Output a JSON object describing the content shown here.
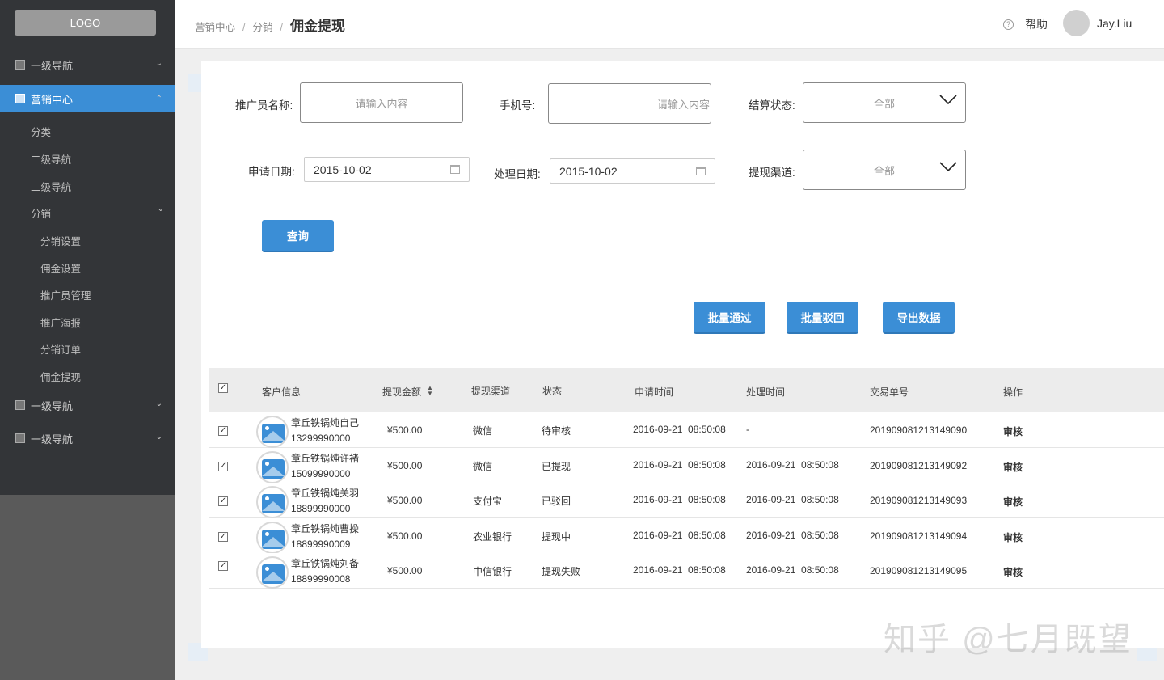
{
  "sidebar": {
    "logo": "LOGO",
    "items": [
      {
        "label": "一级导航"
      },
      {
        "label": "营销中心"
      },
      {
        "label": "分类"
      },
      {
        "label": "二级导航"
      },
      {
        "label": "二级导航"
      },
      {
        "label": "分销"
      },
      {
        "label": "分销设置"
      },
      {
        "label": "佣金设置"
      },
      {
        "label": "推广员管理"
      },
      {
        "label": "推广海报"
      },
      {
        "label": "分销订单"
      },
      {
        "label": "佣金提现"
      },
      {
        "label": "一级导航"
      },
      {
        "label": "一级导航"
      }
    ]
  },
  "header": {
    "breadcrumb": [
      "营销中心",
      "分销",
      "佣金提现"
    ],
    "sep": "/",
    "help": "帮助",
    "help_icon": "?",
    "user": "Jay.Liu"
  },
  "filters": {
    "promoter_label": "推广员名称:",
    "promoter_placeholder": "请输入内容",
    "phone_label": "手机号:",
    "phone_placeholder": "请输入内容",
    "settle_label": "结算状态:",
    "settle_value": "全部",
    "apply_date_label": "申请日期:",
    "apply_date": "2015-10-02",
    "process_date_label": "处理日期:",
    "process_date": "2015-10-02",
    "channel_label": "提现渠道:",
    "channel_value": "全部",
    "query_button": "查询"
  },
  "actions": {
    "batch_approve": "批量通过",
    "batch_reject": "批量驳回",
    "export": "导出数据"
  },
  "table": {
    "headers": [
      "客户信息",
      "提现金额",
      "提现渠道",
      "状态",
      "申请时间",
      "处理时间",
      "交易单号",
      "操作"
    ],
    "rows": [
      {
        "name": "章丘铁锅炖自己",
        "phone": "13299990000",
        "amount": "¥500.00",
        "channel": "微信",
        "status": "待审核",
        "apply_time": "2016-09-21  08:50:08",
        "process_time": "-",
        "order": "201909081213149090",
        "action": "审核"
      },
      {
        "name": "章丘铁锅炖许褚",
        "phone": "15099990000",
        "amount": "¥500.00",
        "channel": "微信",
        "status": "已提现",
        "apply_time": "2016-09-21  08:50:08",
        "process_time": "2016-09-21  08:50:08",
        "order": "201909081213149092",
        "action": "审核"
      },
      {
        "name": "章丘铁锅炖关羽",
        "phone": "18899990000",
        "amount": "¥500.00",
        "channel": "支付宝",
        "status": "已驳回",
        "apply_time": "2016-09-21  08:50:08",
        "process_time": "2016-09-21  08:50:08",
        "order": "201909081213149093",
        "action": "审核"
      },
      {
        "name": "章丘铁锅炖曹操",
        "phone": "18899990009",
        "amount": "¥500.00",
        "channel": "农业银行",
        "status": "提现中",
        "apply_time": "2016-09-21  08:50:08",
        "process_time": "2016-09-21  08:50:08",
        "order": "201909081213149094",
        "action": "审核"
      },
      {
        "name": "章丘铁锅炖刘备",
        "phone": "18899990008",
        "amount": "¥500.00",
        "channel": "中信银行",
        "status": "提现失败",
        "apply_time": "2016-09-21  08:50:08",
        "process_time": "2016-09-21  08:50:08",
        "order": "201909081213149095",
        "action": "审核"
      }
    ]
  },
  "watermark": "知乎 @七月既望",
  "colors": {
    "accent": "#3b8ed6",
    "sidebar": "#333538"
  }
}
